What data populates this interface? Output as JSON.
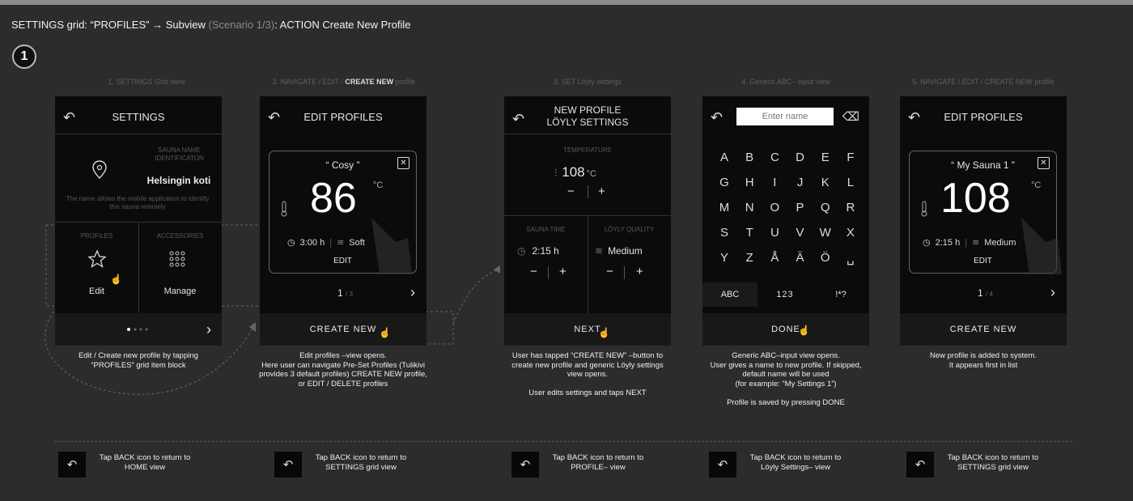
{
  "header": {
    "title_part1": "SETTINGS grid: “PROFILES”",
    "arrow": "→",
    "title_part2": "Subview",
    "scenario": "(Scenario 1/3)",
    "title_part3": ": ACTION Create New Profile",
    "badge": "1"
  },
  "steps": [
    {
      "label": "1. SETTINGS Grid view"
    },
    {
      "label_pre": "2. NAVIGATE / EDIT / ",
      "label_bold": "CREATE NEW",
      "label_post": " profile"
    },
    {
      "label": "3. SET Löyly settings"
    },
    {
      "label": "4. Generic ABC– input view"
    },
    {
      "label": "5. NAVIGATE / EDIT / CREATE NEW profile"
    }
  ],
  "screen1": {
    "back": "↶",
    "title": "SETTINGS",
    "sauna_name_label1": "SAUNA NAME",
    "sauna_name_label2": "IDENTIFICATON",
    "sauna_name": "Helsingin koti",
    "info": "The name allows the mobile application to identify this sauna remotely",
    "profiles_label": "PROFILES",
    "accessories_label": "ACCESSORIES",
    "profiles_action": "Edit",
    "accessories_action": "Manage",
    "chevron": "›"
  },
  "screen2": {
    "back": "↶",
    "title": "EDIT PROFILES",
    "profile_name": "“ Cosy ”",
    "temp": "86",
    "unit": "°C",
    "time": "3:00 h",
    "quality": "Soft",
    "edit": "EDIT",
    "page": "1",
    "page_total": "/ 3",
    "button": "CREATE NEW"
  },
  "screen3": {
    "back": "↶",
    "title_line1": "NEW PROFILE",
    "title_line2": "LÖYLY SETTINGS",
    "temp_label": "TEMPERATURE",
    "temp": "108",
    "unit": "°C",
    "minus": "−",
    "plus": "+",
    "time_label": "SAUNA TIME",
    "time": "2:15 h",
    "quality_label": "LÖYLY QUALITY",
    "quality": "Medium",
    "button": "NEXT"
  },
  "screen4": {
    "back": "↶",
    "placeholder": "Enter name",
    "backspace": "⌫",
    "rows": [
      [
        "A",
        "B",
        "C",
        "D",
        "E",
        "F"
      ],
      [
        "G",
        "H",
        "I",
        "J",
        "K",
        "L"
      ],
      [
        "M",
        "N",
        "O",
        "P",
        "Q",
        "R"
      ],
      [
        "S",
        "T",
        "U",
        "V",
        "W",
        "X"
      ],
      [
        "Y",
        "Z",
        "Å",
        "Ä",
        "Ö",
        "␣"
      ]
    ],
    "mode_abc": "ABC",
    "mode_num": "123",
    "mode_sym": "!*?",
    "button": "DONE"
  },
  "screen5": {
    "back": "↶",
    "title": "EDIT PROFILES",
    "profile_name": "“ My Sauna 1 ”",
    "temp": "108",
    "unit": "°C",
    "time": "2:15 h",
    "quality": "Medium",
    "edit": "EDIT",
    "page": "1",
    "page_total": "/ 4",
    "button": "CREATE NEW"
  },
  "captions": {
    "c1": [
      "Edit / Create new profile by tapping",
      "“PROFILES” grid item block"
    ],
    "c2": [
      "Edit profiles –view opens.",
      "Here user can navigate Pre-Set Profiles (Tulikivi",
      "provides 3 default profiles) CREATE NEW profile,",
      "or EDIT / DELETE profiles"
    ],
    "c3": [
      "User has tapped “CREATE NEW” –button to",
      "create new profile and generic Löyly settings",
      "view opens.",
      "",
      "User edits settings and taps NEXT"
    ],
    "c4": [
      "Generic ABC–input view opens.",
      "User gives a name to new profile. If skipped,",
      "default name will be used",
      "(for example: “My Settings 1”)",
      "",
      "Profile is saved by pressing DONE"
    ],
    "c5": [
      "New profile is added to system.",
      "It appears first in list"
    ]
  },
  "back_hints": [
    [
      "Tap BACK icon to return to",
      "HOME view"
    ],
    [
      "Tap BACK icon to return to",
      "SETTINGS grid view"
    ],
    [
      "Tap BACK icon to return to",
      "PROFILE– view"
    ],
    [
      "Tap BACK icon to return to",
      "Löyly Settings– view"
    ],
    [
      "Tap BACK icon to return to",
      "SETTINGS grid view"
    ]
  ],
  "icons": {
    "pin": "location-pin-icon",
    "star": "star-icon",
    "grid": "dots-grid-icon",
    "thermo": "thermometer-icon",
    "clock": "clock-icon",
    "steam": "steam-icon",
    "hand": "pointing-hand-icon"
  }
}
